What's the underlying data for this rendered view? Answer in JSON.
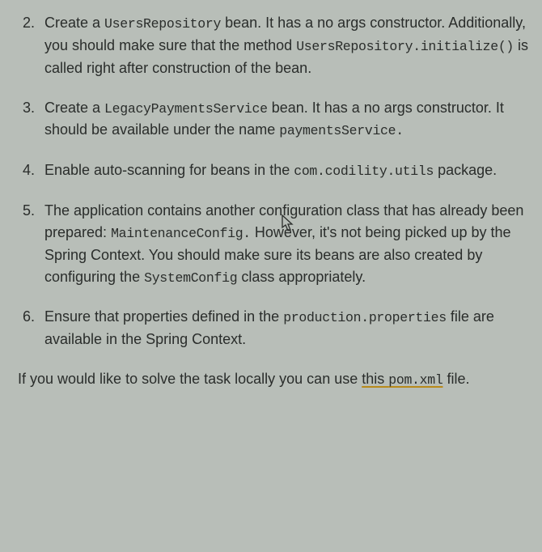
{
  "items": [
    {
      "t1": "Create a ",
      "c1": "UsersRepository",
      "t2": " bean. It has a no args constructor. Additionally, you should make sure that the method ",
      "c2": "UsersRepository.initialize()",
      "t3": " is called right after construction of the bean."
    },
    {
      "t1": "Create a ",
      "c1": "LegacyPaymentsService",
      "t2": " bean. It has a no args constructor. It should be available under the name ",
      "c2": "paymentsService.",
      "t3": ""
    },
    {
      "t1": "Enable auto-scanning for beans in the ",
      "c1": "com.codility.utils",
      "t2": " package.",
      "c2": "",
      "t3": ""
    },
    {
      "t1": "The application contains another configuration class that has already been prepared: ",
      "c1": "MaintenanceConfig.",
      "t2": " However, it's not being picked up by the Spring Context. You should make sure its beans are also created by configuring the ",
      "c2": "SystemConfig",
      "t3": " class appropriately."
    },
    {
      "t1": "Ensure that properties defined in the ",
      "c1": "production.properties",
      "t2": " file are available in the Spring Context.",
      "c2": "",
      "t3": ""
    }
  ],
  "footer": {
    "t1": "If you would like to solve the task locally you can use ",
    "link": "this ",
    "c1": "pom.xml",
    "t2": " file."
  }
}
